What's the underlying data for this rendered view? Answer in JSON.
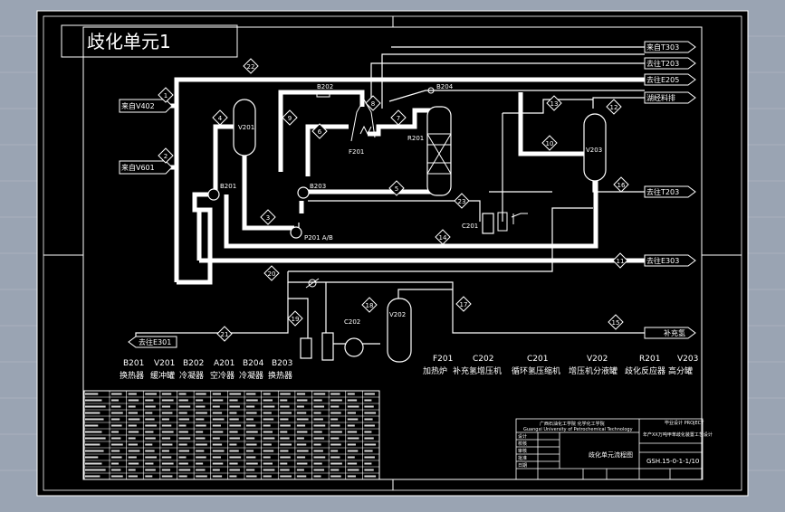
{
  "title": "歧化单元1",
  "colors": {
    "background": "#000000",
    "line": "#ffffff",
    "frame_outer": "#9aa4b3"
  },
  "streams": {
    "from_v402": "来自V402",
    "from_v601": "来自V601",
    "from_t303": "来自T303",
    "to_t203": "去往T203",
    "to_e205": "去往E205",
    "hydrogen_gas": "湖经料排",
    "to_t203b": "去往T203",
    "to_e303": "去往E303",
    "makeup_h2": "补充氢",
    "to_e301": "去往E301"
  },
  "equipment": {
    "v201": "V201",
    "b201": "B201",
    "b202": "B202",
    "b203": "B203",
    "b204": "B204",
    "r201": "R201",
    "f201": "F201",
    "v203": "V203",
    "c201": "C201",
    "p201": "P201 A/B",
    "c202": "C202",
    "v202": "V202"
  },
  "stream_numbers": [
    "1",
    "2",
    "3",
    "4",
    "5",
    "6",
    "7",
    "8",
    "9",
    "10",
    "11",
    "12",
    "13",
    "14",
    "15",
    "16",
    "17",
    "18",
    "19",
    "20",
    "21",
    "22",
    "23"
  ],
  "legend_row1": {
    "codes": [
      "B201",
      "V201",
      "B202",
      "A201",
      "B204",
      "B203"
    ],
    "names": [
      "换热器",
      "缓冲罐",
      "冷凝器",
      "空冷器",
      "冷凝器",
      "换热器"
    ]
  },
  "legend_row2": {
    "codes": [
      "F201",
      "C202",
      "C201",
      "V202",
      "R201",
      "V203"
    ],
    "names": [
      "加热炉",
      "补充氢增压机",
      "循环氢压缩机",
      "增压机分液罐",
      "歧化反应器",
      "高分罐"
    ]
  },
  "title_block": {
    "school": "广西石油化工学院 化学化工学院",
    "school_en": "Guangxi University of Petrochemical Technology",
    "project_title": "毕业设计 PROJECT",
    "project_sub": "年产XX万吨甲苯歧化装置工艺设计",
    "drawing_name": "歧化单元流程图",
    "drawing_no": "GSH.15-0-1-1/10",
    "rows": [
      "设计",
      "校核",
      "审核",
      "批准",
      "日期"
    ]
  }
}
